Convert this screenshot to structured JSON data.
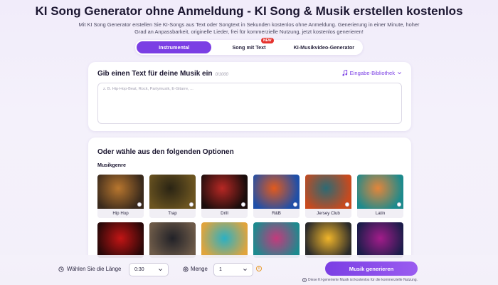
{
  "header": {
    "title": "KI Song Generator ohne Anmeldung - KI Song & Musik erstellen kostenlos",
    "subtitle": "Mit KI Song Generator erstellen Sie KI-Songs aus Text oder Songtext in Sekunden kostenlos ohne Anmeldung. Generierung in einer Minute, hoher Grad an Anpassbarkeit, originelle Lieder, frei für kommerzielle Nutzung, jetzt kostenlos generieren!"
  },
  "tabs": [
    {
      "label": "Instrumental",
      "active": true
    },
    {
      "label": "Song mit Text",
      "badge": "NEW"
    },
    {
      "label": "KI-Musikvideo-Generator"
    }
  ],
  "prompt_card": {
    "heading": "Gib einen Text für deine Musik ein",
    "counter": "0/1000",
    "library_label": "Eingabe-Bibliothek",
    "placeholder": "z. B. Hip-Hop-Beat, Rock, Partymusik, E-Gitarre, ..."
  },
  "options_card": {
    "heading": "Oder wähle aus den folgenden Optionen",
    "section": "Musikgenre",
    "genres": [
      {
        "label": "Hip Hop",
        "colors": [
          "#3a2a1c",
          "#b8762e"
        ]
      },
      {
        "label": "Trap",
        "colors": [
          "#6b5420",
          "#2a2414"
        ]
      },
      {
        "label": "Drill",
        "colors": [
          "#1b0d0c",
          "#b72824"
        ]
      },
      {
        "label": "R&B",
        "colors": [
          "#1f4fa8",
          "#e25a1d"
        ]
      },
      {
        "label": "Jersey Club",
        "colors": [
          "#c84a1e",
          "#2c6a74"
        ]
      },
      {
        "label": "Latin",
        "colors": [
          "#1d8a8c",
          "#e4853a"
        ]
      }
    ],
    "row2_colors": [
      [
        "#c21515",
        "#2a0808"
      ],
      [
        "#222228",
        "#6d5a48"
      ],
      [
        "#2bb0c4",
        "#e0a43c"
      ],
      [
        "#c43a7c",
        "#1c8a8e"
      ],
      [
        "#f0b52a",
        "#2a2a2a"
      ],
      [
        "#a21c8a",
        "#1c1c4a"
      ]
    ]
  },
  "footer": {
    "length_label": "Wählen Sie die Länge",
    "length_value": "0:30",
    "quantity_label": "Menge",
    "quantity_value": "1",
    "generate_label": "Musik generieren",
    "note": "Diese KI-generierte Musik ist kostenlos für die kommerzielle Nutzung."
  },
  "colors": {
    "accent": "#7b3fe4"
  }
}
